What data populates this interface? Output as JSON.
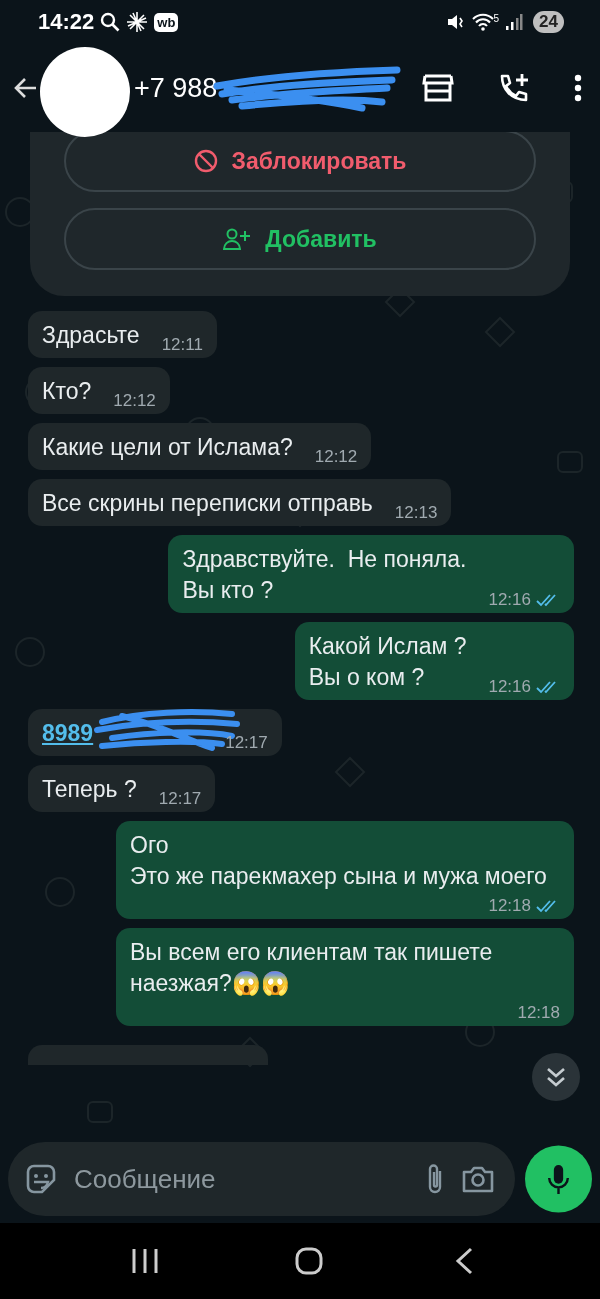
{
  "status_bar": {
    "time": "14:22",
    "app_badge": "wb",
    "wifi_label": "5",
    "battery": "24"
  },
  "header": {
    "title": "+7 988"
  },
  "contact_card": {
    "actions": [
      {
        "kind": "block",
        "label": "Заблокировать"
      },
      {
        "kind": "add",
        "label": "Добавить"
      }
    ]
  },
  "messages": [
    {
      "outgoing": false,
      "kind": "text",
      "text": "Здрасьте",
      "time": "12:11"
    },
    {
      "outgoing": false,
      "kind": "text",
      "text": "Кто?",
      "time": "12:12"
    },
    {
      "outgoing": false,
      "kind": "text",
      "text": "Какие цели от Ислама?",
      "time": "12:12"
    },
    {
      "outgoing": false,
      "kind": "text",
      "text": "Все скрины переписки отправь",
      "time": "12:13"
    },
    {
      "outgoing": true,
      "kind": "text",
      "text": "Здравствуйте.  Не поняла.\nВы кто ?",
      "time": "12:16",
      "read": true
    },
    {
      "outgoing": true,
      "kind": "text",
      "text": "Какой Ислам ?\nВы о ком ?",
      "time": "12:16",
      "read": true
    },
    {
      "outgoing": false,
      "kind": "link",
      "text": "8989",
      "time": "12:17"
    },
    {
      "outgoing": false,
      "kind": "text",
      "text": "Теперь ?",
      "time": "12:17"
    },
    {
      "outgoing": true,
      "kind": "text",
      "text": "Ого\nЭто же парекмахер сына и мужа моего",
      "time": "12:18",
      "read": true
    },
    {
      "outgoing": true,
      "kind": "text",
      "text": "Вы всем его клиентам так пишете наезжая?😱😱",
      "time": "12:18"
    }
  ],
  "composer": {
    "placeholder": "Сообщение"
  }
}
